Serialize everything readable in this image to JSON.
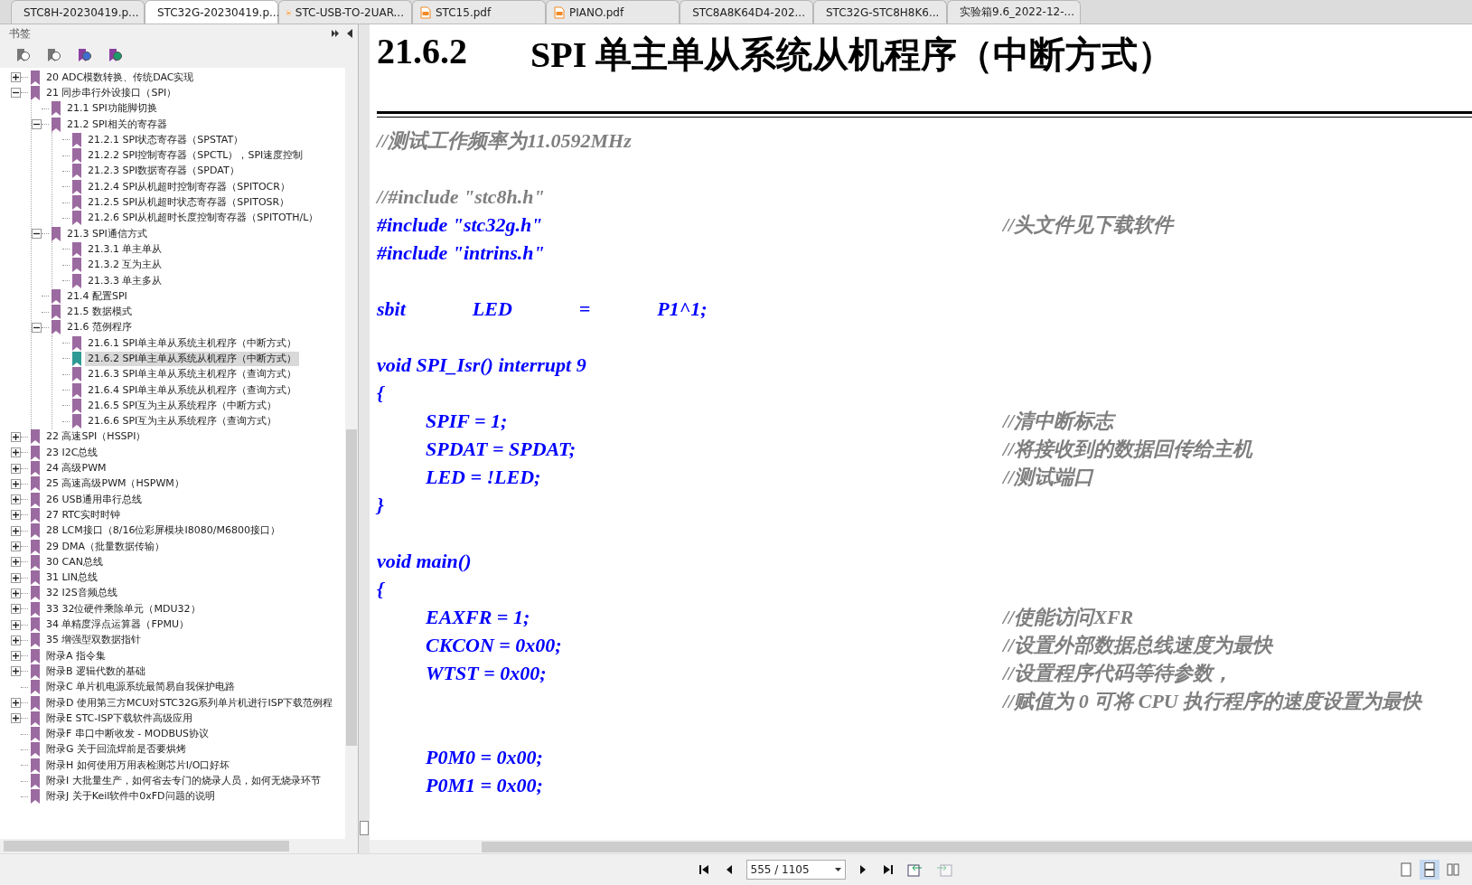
{
  "tabs": [
    {
      "label": "STC8H-20230419.p...",
      "selected": false
    },
    {
      "label": "STC32G-20230419.p...",
      "selected": true
    },
    {
      "label": "STC-USB-TO-2UAR...",
      "selected": false
    },
    {
      "label": "STC15.pdf",
      "selected": false
    },
    {
      "label": "PIANO.pdf",
      "selected": false
    },
    {
      "label": "STC8A8K64D4-202...",
      "selected": false
    },
    {
      "label": "STC32G-STC8H8K6...",
      "selected": false
    },
    {
      "label": "实验箱9.6_2022-12-...",
      "selected": false
    }
  ],
  "sidebar": {
    "title": "书签",
    "items": [
      {
        "label": "20 ADC模数转换、传统DAC实现",
        "kind": "folder",
        "expanded": false,
        "selected": false
      },
      {
        "label": "21 同步串行外设接口（SPI）",
        "kind": "folder",
        "expanded": true,
        "selected": false,
        "children": [
          {
            "label": "21.1 SPI功能脚切换",
            "kind": "leaf",
            "selected": false
          },
          {
            "label": "21.2 SPI相关的寄存器",
            "kind": "folder",
            "expanded": true,
            "selected": false,
            "children": [
              {
                "label": "21.2.1 SPI状态寄存器（SPSTAT）",
                "kind": "leaf",
                "selected": false
              },
              {
                "label": "21.2.2 SPI控制寄存器（SPCTL），SPI速度控制",
                "kind": "leaf",
                "selected": false
              },
              {
                "label": "21.2.3 SPI数据寄存器（SPDAT）",
                "kind": "leaf",
                "selected": false
              },
              {
                "label": "21.2.4 SPI从机超时控制寄存器（SPITOCR）",
                "kind": "leaf",
                "selected": false
              },
              {
                "label": "21.2.5 SPI从机超时状态寄存器（SPITOSR）",
                "kind": "leaf",
                "selected": false
              },
              {
                "label": "21.2.6 SPI从机超时长度控制寄存器（SPITOTH/L）",
                "kind": "leaf",
                "selected": false
              }
            ]
          },
          {
            "label": "21.3 SPI通信方式",
            "kind": "folder",
            "expanded": true,
            "selected": false,
            "children": [
              {
                "label": "21.3.1 单主单从",
                "kind": "leaf",
                "selected": false
              },
              {
                "label": "21.3.2 互为主从",
                "kind": "leaf",
                "selected": false
              },
              {
                "label": "21.3.3 单主多从",
                "kind": "leaf",
                "selected": false
              }
            ]
          },
          {
            "label": "21.4 配置SPI",
            "kind": "leaf",
            "selected": false
          },
          {
            "label": "21.5 数据模式",
            "kind": "leaf",
            "selected": false
          },
          {
            "label": "21.6 范例程序",
            "kind": "folder",
            "expanded": true,
            "selected": false,
            "children": [
              {
                "label": "21.6.1 SPI单主单从系统主机程序（中断方式）",
                "kind": "leaf",
                "selected": false
              },
              {
                "label": "21.6.2 SPI单主单从系统从机程序（中断方式）",
                "kind": "leaf",
                "selected": true
              },
              {
                "label": "21.6.3 SPI单主单从系统主机程序（查询方式）",
                "kind": "leaf",
                "selected": false
              },
              {
                "label": "21.6.4 SPI单主单从系统从机程序（查询方式）",
                "kind": "leaf",
                "selected": false
              },
              {
                "label": "21.6.5 SPI互为主从系统程序（中断方式）",
                "kind": "leaf",
                "selected": false
              },
              {
                "label": "21.6.6 SPI互为主从系统程序（查询方式）",
                "kind": "leaf",
                "selected": false
              }
            ]
          }
        ]
      },
      {
        "label": "22 高速SPI（HSSPI）",
        "kind": "folder",
        "expanded": false,
        "selected": false
      },
      {
        "label": "23 I2C总线",
        "kind": "folder",
        "expanded": false,
        "selected": false
      },
      {
        "label": "24 高级PWM",
        "kind": "folder",
        "expanded": false,
        "selected": false
      },
      {
        "label": "25 高速高级PWM（HSPWM）",
        "kind": "folder",
        "expanded": false,
        "selected": false
      },
      {
        "label": "26 USB通用串行总线",
        "kind": "folder",
        "expanded": false,
        "selected": false
      },
      {
        "label": "27 RTC实时时钟",
        "kind": "folder",
        "expanded": false,
        "selected": false
      },
      {
        "label": "28 LCM接口（8/16位彩屏模块I8080/M6800接口）",
        "kind": "folder",
        "expanded": false,
        "selected": false
      },
      {
        "label": "29 DMA（批量数据传输）",
        "kind": "folder",
        "expanded": false,
        "selected": false
      },
      {
        "label": "30 CAN总线",
        "kind": "folder",
        "expanded": false,
        "selected": false
      },
      {
        "label": "31 LIN总线",
        "kind": "folder",
        "expanded": false,
        "selected": false
      },
      {
        "label": "32 I2S音频总线",
        "kind": "folder",
        "expanded": false,
        "selected": false
      },
      {
        "label": "33 32位硬件乘除单元（MDU32）",
        "kind": "folder",
        "expanded": false,
        "selected": false
      },
      {
        "label": "34 单精度浮点运算器（FPMU）",
        "kind": "folder",
        "expanded": false,
        "selected": false
      },
      {
        "label": "35 增强型双数据指针",
        "kind": "folder",
        "expanded": false,
        "selected": false
      },
      {
        "label": "附录A 指令集",
        "kind": "folder",
        "expanded": false,
        "selected": false
      },
      {
        "label": "附录B 逻辑代数的基础",
        "kind": "folder",
        "expanded": false,
        "selected": false
      },
      {
        "label": "附录C 单片机电源系统最简易自我保护电路",
        "kind": "leaf",
        "selected": false
      },
      {
        "label": "附录D 使用第三方MCU对STC32G系列单片机进行ISP下载范例程",
        "kind": "folder",
        "expanded": false,
        "selected": false
      },
      {
        "label": "附录E STC-ISP下载软件高级应用",
        "kind": "folder",
        "expanded": false,
        "selected": false
      },
      {
        "label": "附录F 串口中断收发 - MODBUS协议",
        "kind": "leaf",
        "selected": false
      },
      {
        "label": "附录G 关于回流焊前是否要烘烤",
        "kind": "leaf",
        "selected": false
      },
      {
        "label": "附录H 如何使用万用表检测芯片I/O口好坏",
        "kind": "leaf",
        "selected": false
      },
      {
        "label": "附录I 大批量生产，如何省去专门的烧录人员，如何无烧录环节",
        "kind": "leaf",
        "selected": false
      },
      {
        "label": "附录J 关于Keil软件中0xFD问题的说明",
        "kind": "leaf",
        "selected": false
      }
    ]
  },
  "page": {
    "heading_number": "21.6.2",
    "heading_title": "SPI 单主单从系统从机程序（中断方式）",
    "lines": [
      {
        "kind": "comment",
        "parts": [
          "//测试工作频率为11.0592MHz"
        ]
      },
      {
        "kind": "blank"
      },
      {
        "kind": "comment",
        "parts": [
          "//#include \"stc8h.h\""
        ]
      },
      {
        "kind": "code",
        "parts": [
          "#include \"stc32g.h\""
        ],
        "comment": "//头文件见下载软件"
      },
      {
        "kind": "code",
        "parts": [
          "#include \"intrins.h\""
        ]
      },
      {
        "kind": "blank"
      },
      {
        "kind": "code",
        "parts": [
          "sbit",
          "LED",
          "=",
          "P1^1;"
        ]
      },
      {
        "kind": "blank"
      },
      {
        "kind": "code",
        "parts": [
          "void SPI_Isr() interrupt 9"
        ]
      },
      {
        "kind": "code",
        "parts": [
          "{"
        ]
      },
      {
        "kind": "indented",
        "parts": [
          "SPIF = 1;"
        ],
        "comment": "//清中断标志"
      },
      {
        "kind": "indented",
        "parts": [
          "SPDAT = SPDAT;"
        ],
        "comment": "//将接收到的数据回传给主机"
      },
      {
        "kind": "indented",
        "parts": [
          "LED = !LED;"
        ],
        "comment": "//测试端口"
      },
      {
        "kind": "code",
        "parts": [
          "}"
        ]
      },
      {
        "kind": "blank"
      },
      {
        "kind": "code",
        "parts": [
          "void main()"
        ]
      },
      {
        "kind": "code",
        "parts": [
          "{"
        ]
      },
      {
        "kind": "indented",
        "parts": [
          "EAXFR = 1;"
        ],
        "comment": "//使能访问XFR"
      },
      {
        "kind": "indented",
        "parts": [
          "CKCON = 0x00;"
        ],
        "comment": "//设置外部数据总线速度为最快"
      },
      {
        "kind": "indented",
        "parts": [
          "WTST = 0x00;"
        ],
        "comment": "//设置程序代码等待参数，"
      },
      {
        "kind": "continuation",
        "comment": "//赋值为 0 可将 CPU 执行程序的速度设置为最快"
      },
      {
        "kind": "blank"
      },
      {
        "kind": "indented",
        "parts": [
          "P0M0 = 0x00;"
        ]
      },
      {
        "kind": "indented",
        "parts": [
          "P0M1 = 0x00;"
        ]
      }
    ]
  },
  "toolbar": {
    "page_field": "555 / 1105",
    "view_modes": [
      {
        "selected": false
      },
      {
        "selected": true
      },
      {
        "selected": false
      }
    ]
  }
}
